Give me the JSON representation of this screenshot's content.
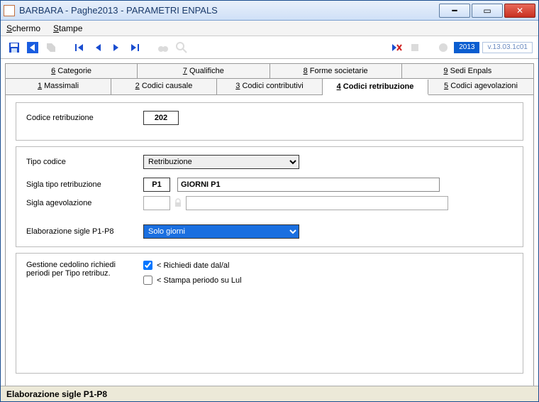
{
  "window": {
    "title": "BARBARA - Paghe2013 - PARAMETRI ENPALS"
  },
  "menu": {
    "schermo": "Schermo",
    "stampe": "Stampe"
  },
  "toolbar": {
    "year": "2013",
    "version": "v.13.03.1c01"
  },
  "tabs_top": {
    "t6": "6 Categorie",
    "t7": "7 Qualifiche",
    "t8": "8 Forme societarie",
    "t9": "9 Sedi Enpals"
  },
  "tabs_bottom": {
    "t1": "1 Massimali",
    "t2": "2 Codici causale",
    "t3": "3 Codici contributivi",
    "t4": "4 Codici retribuzione",
    "t5": "5 Codici agevolazioni"
  },
  "form": {
    "codice_retrib_label": "Codice retribuzione",
    "codice_retrib_value": "202",
    "tipo_codice_label": "Tipo codice",
    "tipo_codice_value": "Retribuzione",
    "sigla_tipo_label": "Sigla tipo retribuzione",
    "sigla_tipo_value": "P1",
    "sigla_tipo_desc": "GIORNI P1",
    "sigla_agev_label": "Sigla agevolazione",
    "sigla_agev_value": "",
    "sigla_agev_desc": "",
    "elab_label": "Elaborazione sigle P1-P8",
    "elab_value": "Solo giorni",
    "gestione_label1": "Gestione cedolino richiedi",
    "gestione_label2": "periodi per Tipo retribuz.",
    "chk1_label": "< Richiedi date dal/al",
    "chk2_label": "< Stampa periodo su Lul"
  },
  "status": {
    "text": "Elaborazione sigle P1-P8"
  }
}
